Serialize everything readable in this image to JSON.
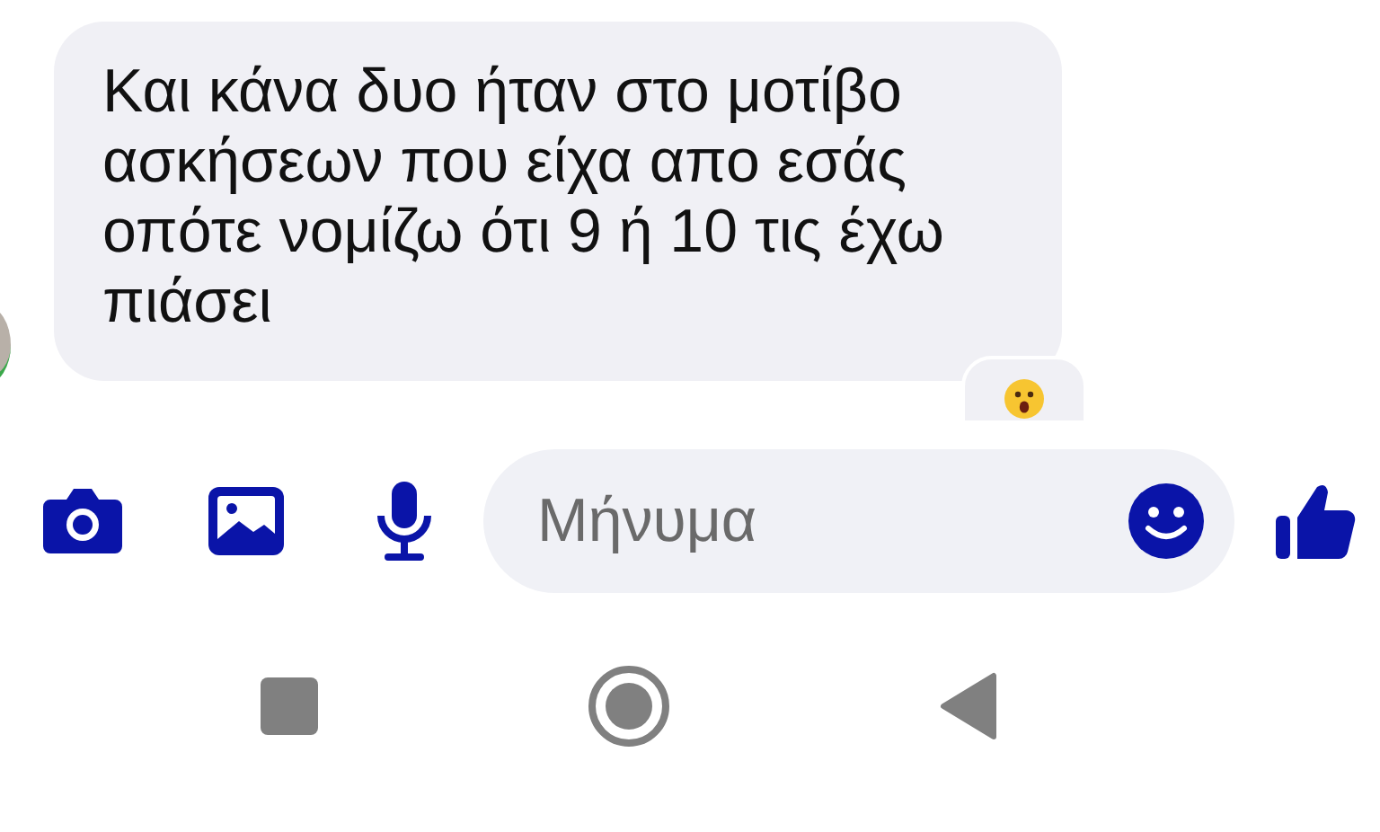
{
  "message": {
    "text": "Και κάνα δυο ήταν στο μοτίβο\nασκήσεων που είχα απο εσάς\nοπότε νομίζω ότι 9 ή 10 τις έχω\nπιάσει",
    "has_reaction": true
  },
  "composer": {
    "placeholder": "Μήνυμα"
  }
}
